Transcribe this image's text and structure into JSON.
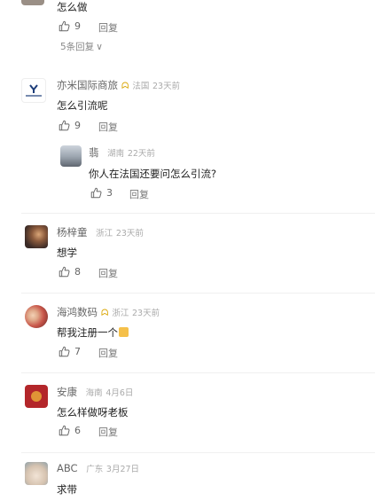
{
  "comments": [
    {
      "text": "怎么做",
      "likes": "9",
      "reply_label": "回复",
      "more_replies": "5条回复"
    },
    {
      "name": "亦米国际商旅",
      "location": "法国",
      "time": "23天前",
      "text": "怎么引流呢",
      "likes": "9",
      "reply_label": "回复",
      "reply": {
        "name": "翡",
        "location": "湖南",
        "time": "22天前",
        "text": "你人在法国还要问怎么引流?",
        "likes": "3",
        "reply_label": "回复"
      }
    },
    {
      "name": "杨梓童",
      "location": "浙江",
      "time": "23天前",
      "text": "想学",
      "likes": "8",
      "reply_label": "回复"
    },
    {
      "name": "海鸿数码",
      "location": "浙江",
      "time": "23天前",
      "text": "帮我注册一个",
      "likes": "7",
      "reply_label": "回复"
    },
    {
      "name": "安康",
      "location": "海南",
      "time": "4月6日",
      "text": "怎么样做呀老板",
      "likes": "6",
      "reply_label": "回复"
    },
    {
      "name": "ABC",
      "location": "广东",
      "time": "3月27日",
      "text": "求带"
    }
  ]
}
